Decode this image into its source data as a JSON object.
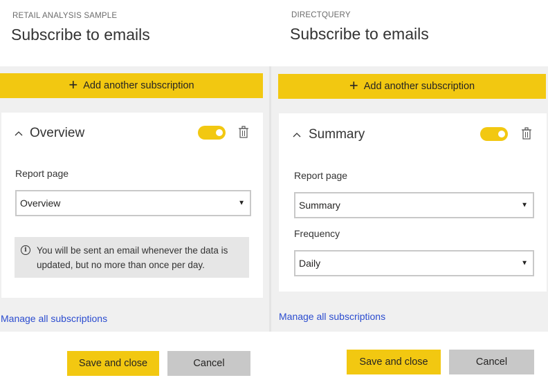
{
  "left": {
    "eyebrow": "RETAIL ANALYSIS SAMPLE",
    "title": "Subscribe to emails",
    "add_subscription_label": "Add another subscription",
    "card": {
      "title": "Overview",
      "toggle_on": true,
      "report_page_label": "Report page",
      "report_page_value": "Overview",
      "info_text": "You will be sent an email whenever the data is updated, but no more than once per day."
    },
    "manage_link": "Manage all subscriptions",
    "save_label": "Save and close",
    "cancel_label": "Cancel"
  },
  "right": {
    "eyebrow": "DIRECTQUERY",
    "title": "Subscribe to emails",
    "add_subscription_label": "Add another subscription",
    "card": {
      "title": "Summary",
      "toggle_on": true,
      "report_page_label": "Report page",
      "report_page_value": "Summary",
      "frequency_label": "Frequency",
      "frequency_value": "Daily"
    },
    "manage_link": "Manage all subscriptions",
    "save_label": "Save and close",
    "cancel_label": "Cancel"
  },
  "icons": {
    "add": "plus-icon",
    "collapse": "chevron-up-icon",
    "delete": "trash-icon",
    "info": "info-icon",
    "dropdown": "caret-down-icon"
  },
  "colors": {
    "accent": "#f2c811",
    "link": "#2b4ccf",
    "secondary_button": "#c8c8c8",
    "panel_background": "#f0f0f0"
  }
}
